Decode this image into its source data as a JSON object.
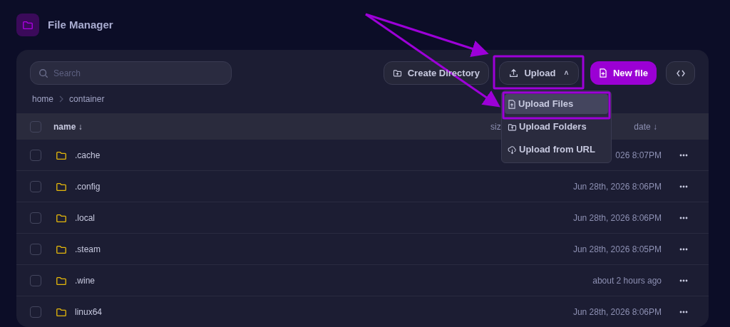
{
  "app": {
    "title": "File Manager"
  },
  "search": {
    "placeholder": "Search"
  },
  "toolbar": {
    "create_directory": "Create Directory",
    "upload": "Upload",
    "upload_caret": "˄",
    "new_file": "New file"
  },
  "breadcrumb": [
    "home",
    "container"
  ],
  "table": {
    "select_all_checked": false,
    "columns": [
      {
        "label": "name ↓"
      },
      {
        "label": "siz"
      },
      {
        "label": "date ↓"
      }
    ],
    "rows": [
      {
        "name": ".cache",
        "date": "026 8:07PM",
        "checked": false
      },
      {
        "name": ".config",
        "date": "Jun 28th, 2026 8:06PM",
        "checked": false
      },
      {
        "name": ".local",
        "date": "Jun 28th, 2026 8:06PM",
        "checked": false
      },
      {
        "name": ".steam",
        "date": "Jun 28th, 2026 8:05PM",
        "checked": false
      },
      {
        "name": ".wine",
        "date": "about 2 hours ago",
        "checked": false
      },
      {
        "name": "linux64",
        "date": "Jun 28th, 2026 8:06PM",
        "checked": false
      }
    ]
  },
  "upload_menu": {
    "items": [
      {
        "label": "Upload Files",
        "kind": "file",
        "selected": true
      },
      {
        "label": "Upload Folders",
        "kind": "folder",
        "selected": false
      },
      {
        "label": "Upload from URL",
        "kind": "url",
        "selected": false
      }
    ]
  }
}
